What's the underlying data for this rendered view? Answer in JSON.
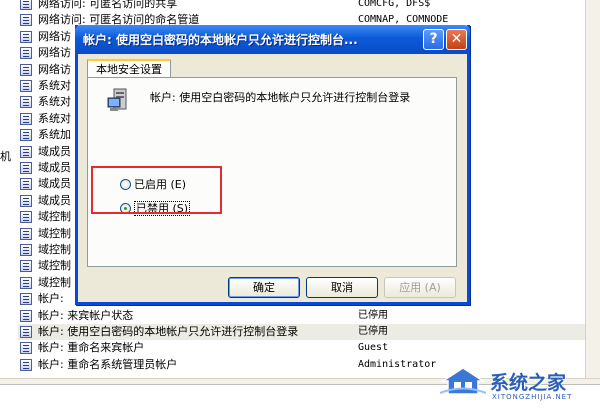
{
  "background": {
    "cut_text": "机",
    "rows": [
      {
        "name": "网络访问: 可匿名访问的共享",
        "value": "COMCFG, DFS$"
      },
      {
        "name": "网络访问: 可匿名访问的命名管道",
        "value": "COMNAP, COMNODE"
      },
      {
        "name": "网络访",
        "value": ""
      },
      {
        "name": "网络访",
        "value": ""
      },
      {
        "name": "网络访",
        "value": ""
      },
      {
        "name": "系统对",
        "value": ""
      },
      {
        "name": "系统对",
        "value": ""
      },
      {
        "name": "系统对",
        "value": ""
      },
      {
        "name": "系统加",
        "value": ""
      },
      {
        "name": "域成员",
        "value": ""
      },
      {
        "name": "域成员",
        "value": ""
      },
      {
        "name": "域成员",
        "value": ""
      },
      {
        "name": "域成员",
        "value": ""
      },
      {
        "name": "域控制",
        "value": ""
      },
      {
        "name": "域控制",
        "value": ""
      },
      {
        "name": "域控制",
        "value": ""
      },
      {
        "name": "域控制",
        "value": ""
      },
      {
        "name": "域控制",
        "value": ""
      },
      {
        "name": "帐户:",
        "value": ""
      },
      {
        "name": "帐户: 来宾帐户状态",
        "value": "已停用"
      },
      {
        "name": "帐户: 使用空白密码的本地帐户只允许进行控制台登录",
        "value": "已停用"
      },
      {
        "name": "帐户: 重命名来宾帐户",
        "value": "Guest"
      },
      {
        "name": "帐户: 重命名系统管理员帐户",
        "value": "Administrator"
      }
    ],
    "partial_row_value": "已停用"
  },
  "dialog": {
    "title": "帐户: 使用空白密码的本地帐户只允许进行控制台...",
    "help_glyph": "?",
    "close_glyph": "✕",
    "tab_label": "本地安全设置",
    "description": "帐户: 使用空白密码的本地帐户只允许进行控制台登录",
    "options": [
      {
        "label": "已启用 (E)",
        "selected": false
      },
      {
        "label": "已禁用 (S)",
        "selected": true
      }
    ],
    "buttons": {
      "ok": "确定",
      "cancel": "取消",
      "apply": "应用 (A)"
    },
    "highlight_color": "#e52b2b"
  },
  "watermark": {
    "title": "系统之家",
    "subtitle": "XITONGZHIJIA.NET"
  }
}
